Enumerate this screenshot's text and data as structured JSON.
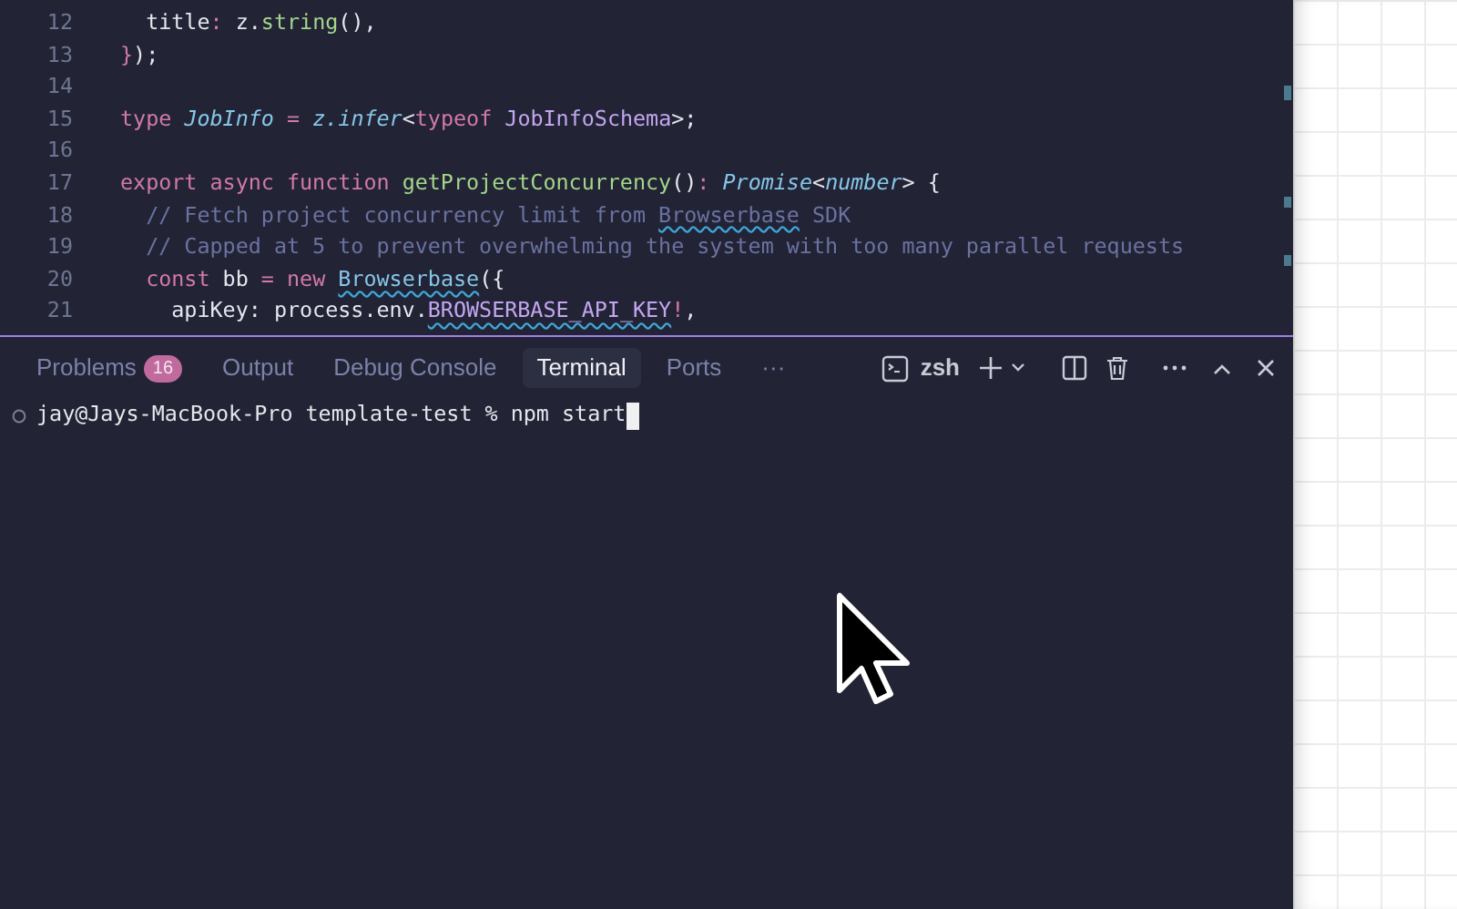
{
  "editor": {
    "lines": [
      {
        "number": "12",
        "tokens": [
          {
            "kind": "prop",
            "text": "  title"
          },
          {
            "kind": "op",
            "text": ": "
          },
          {
            "kind": "plain",
            "text": "z."
          },
          {
            "kind": "fn",
            "text": "string"
          },
          {
            "kind": "plain",
            "text": "(),"
          }
        ]
      },
      {
        "number": "13",
        "tokens": [
          {
            "kind": "op",
            "text": "}"
          },
          {
            "kind": "plain",
            "text": ");"
          }
        ]
      },
      {
        "number": "14"
      },
      {
        "number": "15",
        "tokens": [
          {
            "kind": "kw",
            "text": "type "
          },
          {
            "kind": "type",
            "text": "JobInfo"
          },
          {
            "kind": "op",
            "text": " = "
          },
          {
            "kind": "type",
            "text": "z.infer"
          },
          {
            "kind": "plain",
            "text": "<"
          },
          {
            "kind": "kw",
            "text": "typeof "
          },
          {
            "kind": "cls",
            "text": "JobInfoSchema"
          },
          {
            "kind": "plain",
            "text": ">;"
          }
        ]
      },
      {
        "number": "16"
      },
      {
        "number": "17",
        "tokens": [
          {
            "kind": "kw",
            "text": "export async function "
          },
          {
            "kind": "fn",
            "text": "getProjectConcurrency"
          },
          {
            "kind": "plain",
            "text": "()"
          },
          {
            "kind": "op",
            "text": ": "
          },
          {
            "kind": "type",
            "text": "Promise"
          },
          {
            "kind": "plain",
            "text": "<"
          },
          {
            "kind": "type",
            "text": "number"
          },
          {
            "kind": "plain",
            "text": "> {"
          }
        ]
      },
      {
        "number": "18",
        "tokens": [
          {
            "kind": "comment",
            "text": "  // Fetch project concurrency limit from "
          },
          {
            "kind": "comment",
            "text": "Browserbase",
            "squiggle": true
          },
          {
            "kind": "comment",
            "text": " SDK"
          }
        ]
      },
      {
        "number": "19",
        "tokens": [
          {
            "kind": "comment",
            "text": "  // Capped at 5 to prevent overwhelming the system with too many parallel requests"
          }
        ]
      },
      {
        "number": "20",
        "tokens": [
          {
            "kind": "kw",
            "text": "  const "
          },
          {
            "kind": "plain",
            "text": "bb"
          },
          {
            "kind": "op",
            "text": " = "
          },
          {
            "kind": "kw",
            "text": "new "
          },
          {
            "kind": "ctor",
            "text": "Browserbase",
            "squiggle": true
          },
          {
            "kind": "plain",
            "text": "({"
          }
        ]
      },
      {
        "number": "21",
        "tokens": [
          {
            "kind": "plain",
            "text": "    apiKey: process.env."
          },
          {
            "kind": "env",
            "text": "BROWSERBASE_API_KEY",
            "squiggle": true
          },
          {
            "kind": "op",
            "text": "!"
          },
          {
            "kind": "plain",
            "text": ","
          }
        ]
      }
    ]
  },
  "panel": {
    "tabs": [
      {
        "label": "Problems",
        "badge": "16",
        "selected": false
      },
      {
        "label": "Output",
        "selected": false
      },
      {
        "label": "Debug Console",
        "selected": false
      },
      {
        "label": "Terminal",
        "selected": true
      },
      {
        "label": "Ports",
        "selected": false
      }
    ],
    "more": "···",
    "shell": "zsh",
    "terminal": {
      "prompt": "jay@Jays-MacBook-Pro template-test % ",
      "command": "npm start"
    }
  }
}
